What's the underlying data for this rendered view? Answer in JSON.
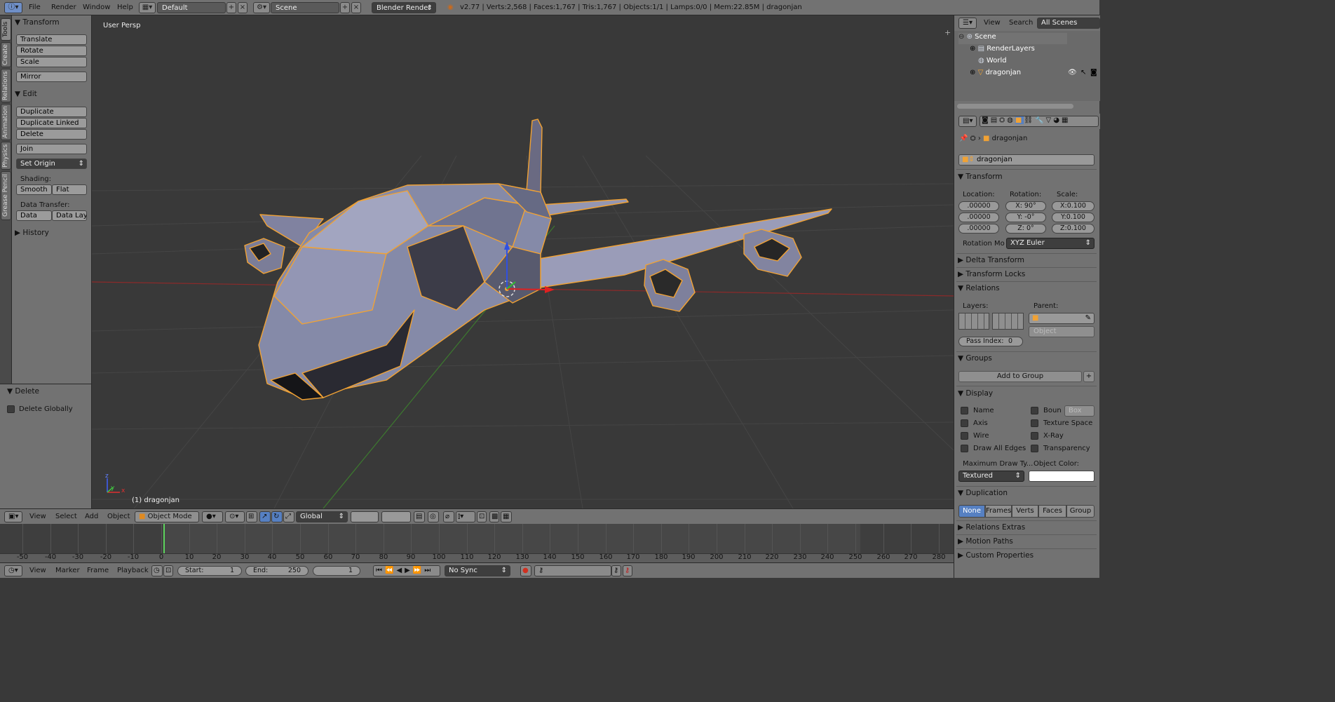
{
  "topbar": {
    "menus": [
      "File",
      "Render",
      "Window",
      "Help"
    ],
    "screen_layout": "Default",
    "scene": "Scene",
    "engine": "Blender Render",
    "stats": "v2.77 | Verts:2,568 | Faces:1,767 | Tris:1,767 | Objects:1/1 | Lamps:0/0 | Mem:22.85M | dragonjan"
  },
  "tool_tabs": [
    "Tools",
    "Create",
    "Relations",
    "Animation",
    "Physics",
    "Grease Pencil"
  ],
  "toolshelf": {
    "transform_title": "Transform",
    "translate": "Translate",
    "rotate": "Rotate",
    "scale": "Scale",
    "mirror": "Mirror",
    "edit_title": "Edit",
    "duplicate": "Duplicate",
    "duplicate_linked": "Duplicate Linked",
    "delete": "Delete",
    "join": "Join",
    "set_origin": "Set Origin",
    "shading_label": "Shading:",
    "smooth": "Smooth",
    "flat": "Flat",
    "data_transfer_label": "Data Transfer:",
    "data": "Data",
    "data_layout": "Data Layo",
    "history_title": "History"
  },
  "operator_panel": {
    "title": "Delete",
    "delete_globally": "Delete Globally"
  },
  "viewport": {
    "view_name": "User Persp",
    "object_label": "(1) dragonjan",
    "axis_z": "z",
    "axis_y": "y",
    "axis_x": "x"
  },
  "view3d_header": {
    "menus": [
      "View",
      "Select",
      "Add",
      "Object"
    ],
    "mode": "Object Mode",
    "orientation": "Global"
  },
  "timeline": {
    "ticks": [
      "-50",
      "-40",
      "-30",
      "-20",
      "-10",
      "0",
      "10",
      "20",
      "30",
      "40",
      "50",
      "60",
      "70",
      "80",
      "90",
      "100",
      "110",
      "120",
      "130",
      "140",
      "150",
      "160",
      "170",
      "180",
      "190",
      "200",
      "210",
      "220",
      "230",
      "240",
      "250",
      "260",
      "270",
      "280"
    ],
    "menus": [
      "View",
      "Marker",
      "Frame",
      "Playback"
    ],
    "start_label": "Start:",
    "start_value": "1",
    "end_label": "End:",
    "end_value": "250",
    "current_frame": "1",
    "sync": "No Sync"
  },
  "outliner": {
    "tabs": [
      "View",
      "Search",
      "All Scenes"
    ],
    "items": [
      "Scene",
      "RenderLayers",
      "World",
      "dragonjan"
    ]
  },
  "properties": {
    "breadcrumb": "dragonjan",
    "object_name": "dragonjan",
    "transform_title": "Transform",
    "location_label": "Location:",
    "rotation_label": "Rotation:",
    "scale_label": "Scale:",
    "location": [
      ".00000",
      ".00000",
      ".00000"
    ],
    "rotation": [
      "X:  90°",
      "Y:  -0°",
      "Z:  0°"
    ],
    "scale": [
      "X:0.100",
      "Y:0.100",
      "Z:0.100"
    ],
    "rotation_mode_label": "Rotation Mo",
    "rotation_mode": "XYZ Euler",
    "delta_transform": "Delta Transform",
    "transform_locks": "Transform Locks",
    "relations": "Relations",
    "layers_label": "Layers:",
    "parent_label": "Parent:",
    "parent_type": "Object",
    "pass_index_label": "Pass Index:",
    "pass_index": "0",
    "groups": "Groups",
    "add_to_group": "Add to Group",
    "display": "Display",
    "display_checks_left": [
      "Name",
      "Axis",
      "Wire",
      "Draw All Edges"
    ],
    "display_checks_right": [
      "Boun",
      "Texture Space",
      "X-Ray",
      "Transparency"
    ],
    "bounds_type": "Box",
    "max_draw_label": "Maximum Draw Ty...",
    "object_color_label": "Object Color:",
    "max_draw": "Textured",
    "duplication": "Duplication",
    "dup_options": [
      "None",
      "Frames",
      "Verts",
      "Faces",
      "Group"
    ],
    "relations_extras": "Relations Extras",
    "motion_paths": "Motion Paths",
    "custom_properties": "Custom Properties"
  },
  "colors": {
    "active_blue": "#5680c2",
    "selection_orange": "#f1a234",
    "frame_green": "#5dd35d"
  }
}
